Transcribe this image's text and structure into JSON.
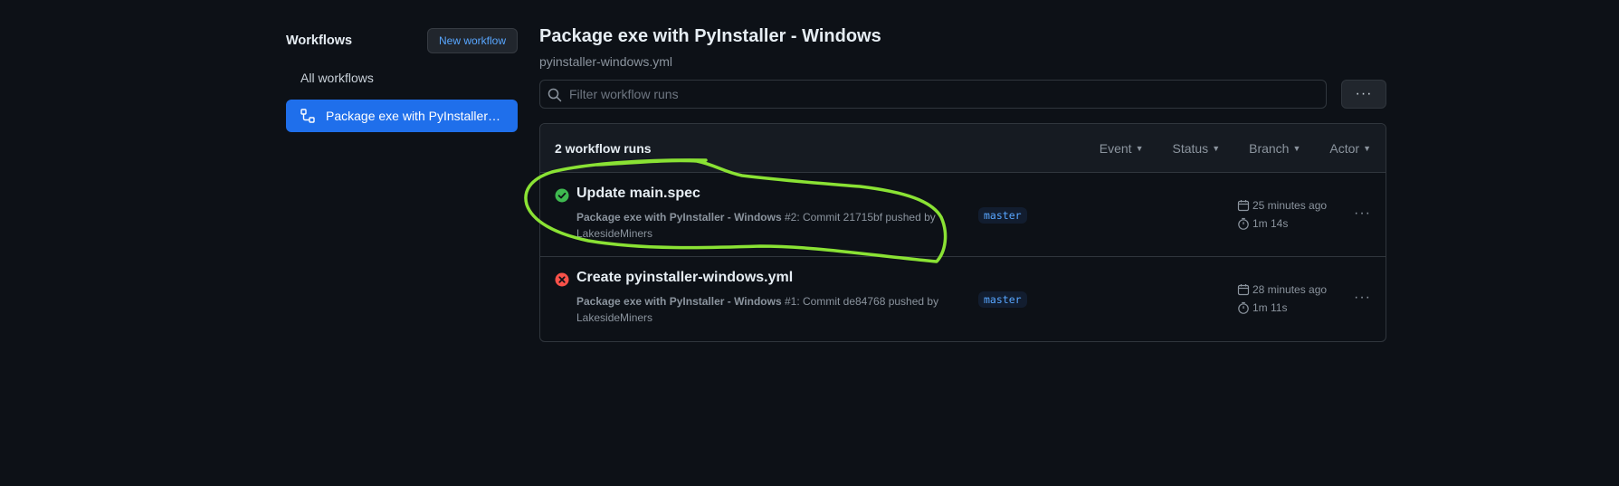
{
  "sidebar": {
    "title": "Workflows",
    "new_workflow_label": "New workflow",
    "items": [
      {
        "label": "All workflows"
      },
      {
        "label": "Package exe with PyInstaller - Windows"
      }
    ]
  },
  "main": {
    "title": "Package exe with PyInstaller - Windows",
    "subtitle": "pyinstaller-windows.yml",
    "filter_placeholder": "Filter workflow runs",
    "more_label": "···"
  },
  "runs": {
    "count_label": "2 workflow runs",
    "filters": [
      "Event",
      "Status",
      "Branch",
      "Actor"
    ],
    "items": [
      {
        "status": "success",
        "title": "Update main.spec",
        "workflow": "Package exe with PyInstaller - Windows",
        "detail": " #2: Commit 21715bf pushed by LakesideMiners",
        "branch": "master",
        "when": "25 minutes ago",
        "duration": "1m 14s"
      },
      {
        "status": "failure",
        "title": "Create pyinstaller-windows.yml",
        "workflow": "Package exe with PyInstaller - Windows",
        "detail": " #1: Commit de84768 pushed by LakesideMiners",
        "branch": "master",
        "when": "28 minutes ago",
        "duration": "1m 11s"
      }
    ]
  },
  "colors": {
    "background": "#0d1117",
    "accent": "#1f6feb",
    "success": "#3fb950",
    "failure": "#f85149",
    "annotation": "#8ae234"
  },
  "icons": [
    "workflow-icon",
    "search-icon",
    "check-circle-icon",
    "x-circle-icon",
    "calendar-icon",
    "stopwatch-icon",
    "kebab-icon"
  ]
}
